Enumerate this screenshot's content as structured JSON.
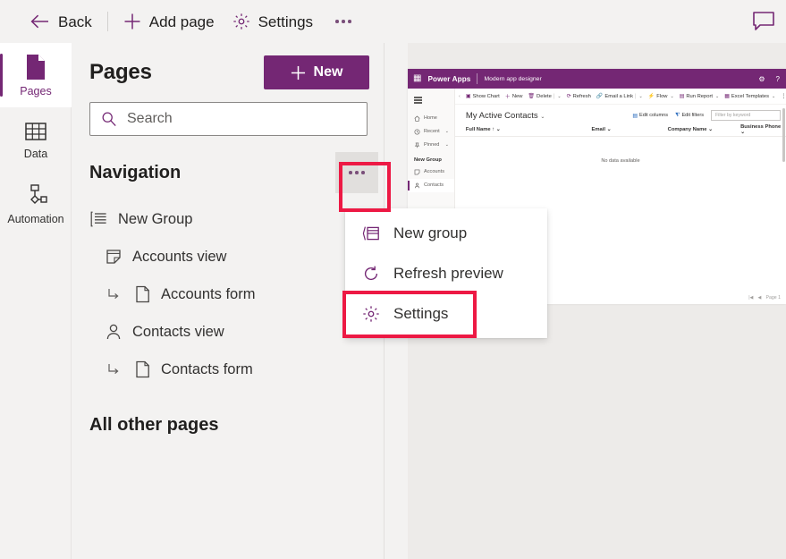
{
  "theme": {
    "accent": "#742774",
    "highlight_red": "#ed1944",
    "panel_bg": "#f3f2f1",
    "canvas_bg": "#edebe9"
  },
  "topbar": {
    "back_label": "Back",
    "add_page_label": "Add page",
    "settings_label": "Settings",
    "overflow_label": "...",
    "comment_icon": "comment-icon"
  },
  "rail": {
    "items": [
      {
        "label": "Pages",
        "icon": "page-icon",
        "selected": true
      },
      {
        "label": "Data",
        "icon": "table-icon",
        "selected": false
      },
      {
        "label": "Automation",
        "icon": "flow-icon",
        "selected": false
      }
    ]
  },
  "panel": {
    "title": "Pages",
    "new_button_label": "New",
    "new_button_icon": "plus-icon",
    "search": {
      "placeholder": "Search",
      "value": "",
      "icon": "search-icon"
    },
    "navigation": {
      "title": "Navigation",
      "more_button_label": "...",
      "tree": [
        {
          "label": "New Group",
          "icon": "group-list-icon",
          "level": 0,
          "has_sub_arrow": false
        },
        {
          "label": "Accounts view",
          "icon": "view-icon",
          "level": 1,
          "has_sub_arrow": false
        },
        {
          "label": "Accounts form",
          "icon": "form-page-icon",
          "level": 2,
          "has_sub_arrow": true
        },
        {
          "label": "Contacts view",
          "icon": "person-icon",
          "level": 1,
          "has_sub_arrow": false
        },
        {
          "label": "Contacts form",
          "icon": "form-page-icon",
          "level": 2,
          "has_sub_arrow": true
        }
      ]
    },
    "all_other_pages_title": "All other pages"
  },
  "context_menu": {
    "items": [
      {
        "label": "New group",
        "icon": "new-group-icon"
      },
      {
        "label": "Refresh preview",
        "icon": "refresh-icon"
      },
      {
        "label": "Settings",
        "icon": "gear-icon"
      }
    ]
  },
  "highlights": [
    {
      "name": "navigation-more-button-highlight",
      "target": "navigation-more-button"
    },
    {
      "name": "settings-menu-item-highlight",
      "target": "context-menu-item-settings"
    }
  ],
  "preview": {
    "header": {
      "waffle_icon": "waffle-icon",
      "brand": "Power Apps",
      "app_name": "Modern app designer",
      "settings_icon": "gear-icon",
      "help_icon": "help-icon"
    },
    "sidenav": {
      "hamburger_icon": "hamburger-icon",
      "items": [
        {
          "label": "Home",
          "icon": "home-icon",
          "chevron": false,
          "selected": false
        },
        {
          "label": "Recent",
          "icon": "recent-icon",
          "chevron": true,
          "selected": false
        },
        {
          "label": "Pinned",
          "icon": "pin-icon",
          "chevron": true,
          "selected": false
        }
      ],
      "group_label": "New Group",
      "group_items": [
        {
          "label": "Accounts",
          "icon": "view-icon",
          "selected": false
        },
        {
          "label": "Contacts",
          "icon": "person-icon",
          "selected": true
        }
      ]
    },
    "commandbar": {
      "back_icon": "chevron-left-icon",
      "commands": [
        {
          "label": "Show Chart",
          "icon": "chart-icon",
          "chevron": false
        },
        {
          "label": "New",
          "icon": "plus-icon",
          "chevron": false
        },
        {
          "label": "Delete",
          "icon": "trash-icon",
          "chevron": true
        },
        {
          "label": "Refresh",
          "icon": "refresh-icon",
          "chevron": false
        },
        {
          "label": "Email a Link",
          "icon": "link-icon",
          "chevron": true
        },
        {
          "label": "Flow",
          "icon": "flow-icon",
          "chevron": true
        },
        {
          "label": "Run Report",
          "icon": "report-icon",
          "chevron": true
        },
        {
          "label": "Excel Templates",
          "icon": "excel-icon",
          "chevron": true
        }
      ],
      "overflow_label": "⋮"
    },
    "view": {
      "name": "My Active Contacts",
      "name_chevron": "chevron-down-icon",
      "actions": [
        {
          "label": "Edit columns",
          "icon": "columns-icon"
        },
        {
          "label": "Edit filters",
          "icon": "filter-icon"
        }
      ],
      "filter_placeholder": "Filter by keyword"
    },
    "grid": {
      "columns": [
        "Full Name",
        "Email",
        "Company Name",
        "Business Phone"
      ],
      "sort_column": "Full Name",
      "empty_message": "No data available"
    },
    "pager": {
      "first_icon": "page-first-icon",
      "prev_icon": "page-prev-icon",
      "label": "Page 1"
    }
  }
}
